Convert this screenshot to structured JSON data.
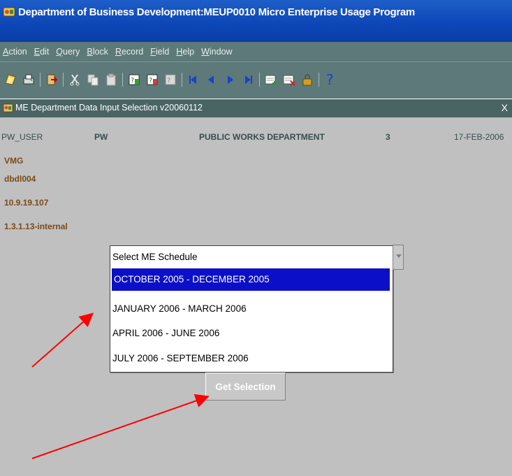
{
  "window": {
    "title": "Department of Business Development:MEUP0010 Micro Enterprise Usage Program"
  },
  "menu": {
    "items": [
      {
        "label": "Action",
        "accel": "A",
        "rest": "ction"
      },
      {
        "label": "Edit",
        "accel": "E",
        "rest": "dit"
      },
      {
        "label": "Query",
        "accel": "Q",
        "rest": "uery"
      },
      {
        "label": "Block",
        "accel": "B",
        "rest": "lock"
      },
      {
        "label": "Record",
        "accel": "R",
        "rest": "ecord"
      },
      {
        "label": "Field",
        "accel": "F",
        "rest": "ield"
      },
      {
        "label": "Help",
        "accel": "H",
        "rest": "elp"
      },
      {
        "label": "Window",
        "accel": "W",
        "rest": "indow"
      }
    ]
  },
  "toolbar": {
    "icons": [
      "save-icon",
      "print-icon",
      "exit-icon",
      "cut-icon",
      "copy-icon",
      "paste-icon",
      "enter-query-icon",
      "execute-query-icon",
      "cancel-query-icon",
      "first-record-icon",
      "previous-record-icon",
      "next-record-icon",
      "last-record-icon",
      "insert-record-icon",
      "delete-record-icon",
      "lock-record-icon",
      "help-icon"
    ]
  },
  "form": {
    "title": "ME Department Data Input Selection v20060112",
    "close_label": "X",
    "header": {
      "user": "PW_USER",
      "dept_code": "PW",
      "dept_name": "PUBLIC WORKS DEPARTMENT",
      "count": "3",
      "date": "17-FEB-2006"
    },
    "info_lines": [
      "VMG",
      "dbdl004",
      "10.9.19.107",
      "1.3.1.13-internal"
    ],
    "schedule_list": {
      "header": "Select ME Schedule",
      "options": [
        "OCTOBER 2005 - DECEMBER 2005",
        "JANUARY  2006 - MARCH 2006",
        "APRIL 2006 - JUNE 2006",
        "JULY 2006 - SEPTEMBER 2006"
      ],
      "selected_index": 0
    },
    "get_selection_label": "Get Selection"
  },
  "colors": {
    "titlebar": "#0d47b8",
    "menubar": "#5e7979",
    "form_bg": "#c0c0c0",
    "selection": "#0b10c8",
    "info_text": "#7b4a16",
    "annotation_arrow": "#ff0000"
  }
}
